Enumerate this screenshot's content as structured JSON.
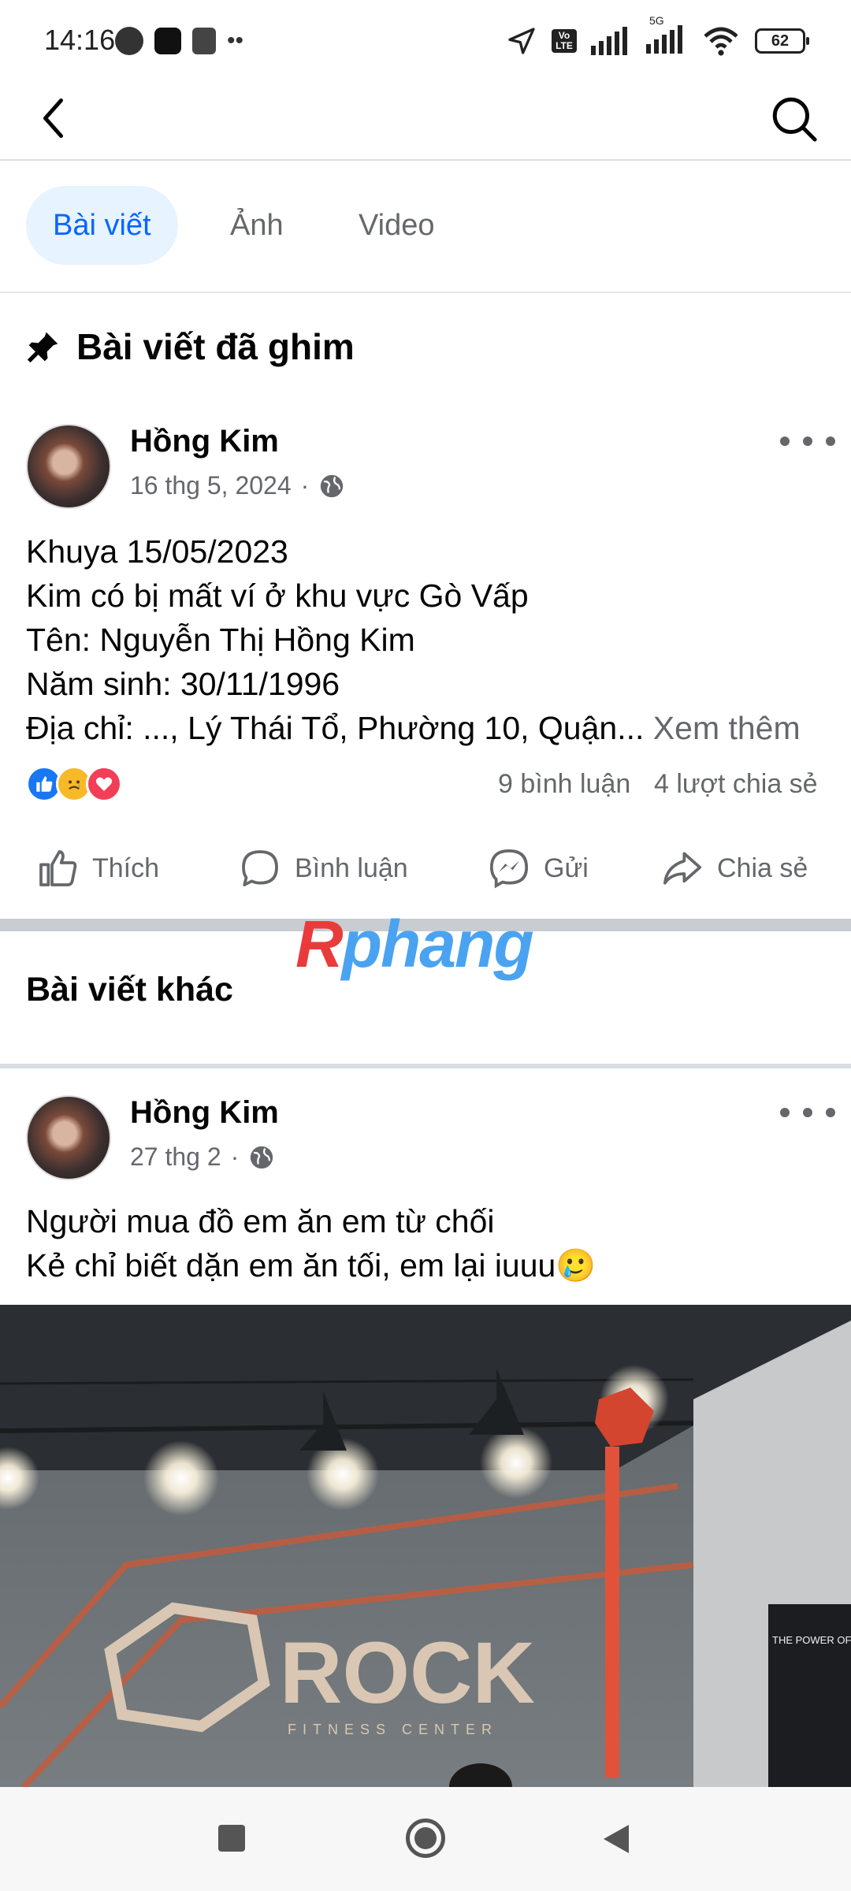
{
  "status_bar": {
    "time": "14:16",
    "battery": "62",
    "network_5g": "5G",
    "volte": "Vo LTE",
    "icons": [
      "ex-badge-icon",
      "square-app-icon",
      "shop-icon",
      "more-dots-icon",
      "location-arrow-icon",
      "signal-icon",
      "wifi-icon",
      "battery-icon"
    ]
  },
  "tabs": {
    "posts": "Bài viết",
    "photos": "Ảnh",
    "videos": "Video"
  },
  "pinned": {
    "title": "Bài viết đã ghim",
    "post": {
      "author": "Hồng Kim",
      "date": "16 thg 5, 2024",
      "lines": [
        "Khuya 15/05/2023",
        "Kim có bị mất ví ở khu vực Gò Vấp",
        "Tên: Nguyễn Thị Hồng Kim",
        "Năm sinh: 30/11/1996",
        "Địa chỉ: ..., Lý Thái Tổ, Phường 10, Quận..."
      ],
      "see_more": "Xem thêm",
      "comments": "9 bình luận",
      "shares": "4 lượt chia sẻ"
    }
  },
  "actions": {
    "like": "Thích",
    "comment": "Bình luận",
    "send": "Gửi",
    "share": "Chia sẻ"
  },
  "watermark": {
    "part1": "R",
    "part2": "phang"
  },
  "other": {
    "title": "Bài viết khác",
    "post": {
      "author": "Hồng Kim",
      "date": "27 thg 2",
      "lines": [
        "Người mua đồ em ăn em từ chối",
        "Kẻ chỉ biết dặn em ăn tối, em lại iuuu🥲"
      ],
      "photo_sign": "ROCK",
      "photo_subsign": "FITNESS CENTER",
      "photo_poster": "THE POWER OF SELF DISCIPLINE IN SPORT"
    }
  },
  "colors": {
    "brand_blue": "#0866ff",
    "muted": "#65676b",
    "tab_active_bg": "#e7f3ff"
  }
}
